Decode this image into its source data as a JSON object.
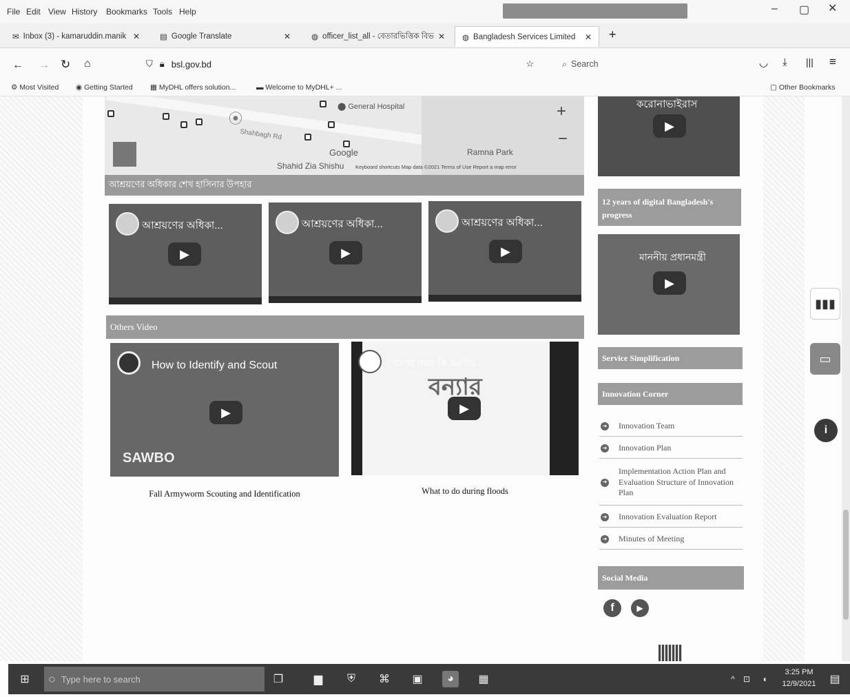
{
  "menu": [
    "File",
    "Edit",
    "View",
    "History",
    "Bookmarks",
    "Tools",
    "Help"
  ],
  "tabs": [
    {
      "label": "Inbox (3) - kamaruddin.manik"
    },
    {
      "label": "Google Translate"
    },
    {
      "label": "officer_list_all - বেতারভিত্তিক বিভ"
    },
    {
      "label": "Bangladesh Services Limited"
    }
  ],
  "url": "bsl.gov.bd",
  "search_placeholder": "Search",
  "bookmarks": [
    "Most Visited",
    "Getting Started",
    "MyDHL offers solution...",
    "Welcome to MyDHL+ ..."
  ],
  "other_bookmarks": "Other Bookmarks",
  "map": {
    "hospital": "General Hospital",
    "road": "Shahbagh Rd",
    "google": "Google",
    "park": "Ramna Park",
    "school": "Shahid Zia Shishu",
    "footer": "Keyboard shortcuts   Map data ©2021   Terms of Use   Report a map error"
  },
  "section1_title": "আশ্রয়ণের অধিকার শেখ হাসিনার উপহার",
  "section1_videos": [
    {
      "title": "আশ্রয়ণের অধিকা..."
    },
    {
      "title": "আশ্রয়ণের অধিকা..."
    },
    {
      "title": "আশ্রয়ণের অধিকা..."
    }
  ],
  "section2_title": "Others Video",
  "section2_videos": [
    {
      "title": "How to Identify and Scout",
      "brand": "SAWBO",
      "caption": "Fall Armyworm Scouting and Identification"
    },
    {
      "title": "বন্যার সময় কি করণীয়",
      "big": "বন্যার",
      "caption": "What to do during floods"
    }
  ],
  "side_top_video": "করোনাভাইরাস",
  "side_progress_title": "12 years of digital Bangladesh's progress",
  "side_video2": "মাননীয় প্রধানমন্ত্রী",
  "service_title": "Service Simplification",
  "innovation_title": "Innovation Corner",
  "innovation_items": [
    "Innovation Team",
    "Innovation Plan",
    "Implementation Action Plan and Evaluation Structure of Innovation Plan",
    "Innovation Evaluation Report",
    "Minutes of Meeting"
  ],
  "social_title": "Social Media",
  "taskbar": {
    "search": "Type here to search",
    "time": "3:25 PM",
    "date": "12/9/2021"
  }
}
